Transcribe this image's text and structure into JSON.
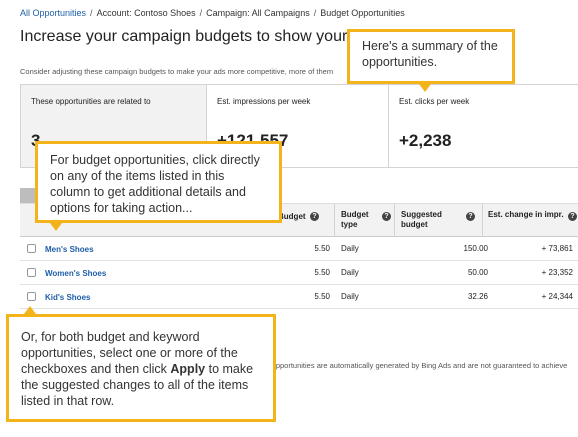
{
  "breadcrumb": {
    "all": "All Opportunities",
    "account": "Account: Contoso Shoes",
    "campaign": "Campaign: All Campaigns",
    "current": "Budget Opportunities",
    "separator": "/"
  },
  "page": {
    "title": "Increase your campaign budgets to show your ads",
    "subtext": "Consider adjusting these campaign budgets to make your ads more competitive, more of them"
  },
  "summary": {
    "related_label": "These opportunities are related to",
    "related_value": "3",
    "impressions_label": "Est. impressions per week",
    "impressions_value": "+121,557",
    "clicks_label": "Est. clicks per week",
    "clicks_value": "+2,238"
  },
  "table": {
    "headers": {
      "budget": "Budget",
      "budget_type": "Budget type",
      "suggested_budget": "Suggested budget",
      "est_change": "Est. change in impr."
    },
    "rows": [
      {
        "name": "Men's Shoes",
        "budget": "5.50",
        "type": "Daily",
        "suggested": "150.00",
        "change": "+ 73,861"
      },
      {
        "name": "Women's Shoes",
        "budget": "5.50",
        "type": "Daily",
        "suggested": "50.00",
        "change": "+ 23,352"
      },
      {
        "name": "Kid's Shoes",
        "budget": "5.50",
        "type": "Daily",
        "suggested": "32.26",
        "change": "+ 24,344"
      }
    ]
  },
  "footnote": "Opportunities are automatically generated by Bing Ads and are not guaranteed to achieve",
  "callouts": {
    "summary": "Here's a summary of the opportunities.",
    "column": "For budget opportunities, click directly on any of the items listed in this column to get additional details and options for taking action...",
    "checkbox_before": "Or, for both budget and keyword opportunities, select one or more of the checkboxes and then click ",
    "checkbox_bold": "Apply",
    "checkbox_after": " to make the suggested changes to all of the items listed in that row."
  },
  "icons": {
    "info": "info-icon"
  },
  "colors": {
    "link": "#1f5ea8",
    "callout_border": "#f2b31b"
  }
}
